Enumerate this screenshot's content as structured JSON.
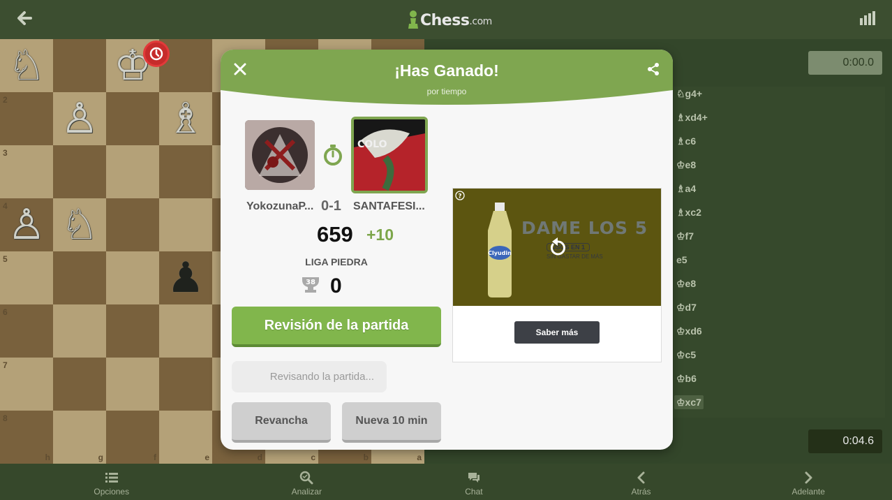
{
  "header": {
    "brand": "Chess",
    "brand_domain": ".com"
  },
  "board": {
    "ranks": [
      "",
      "2",
      "3",
      "4",
      "5",
      "6",
      "7",
      "8"
    ],
    "files": [
      "h",
      "g",
      "f",
      "e",
      "d",
      "c",
      "b",
      "a"
    ],
    "pieces": {
      "0-0": "♘",
      "0-2": "♔",
      "1-1": "♙",
      "1-3": "♗",
      "3-0": "♙",
      "3-1": "♘",
      "4-3": "♟"
    },
    "black_pieces": [
      "4-3"
    ]
  },
  "clocks": {
    "top": "0:00.0",
    "bottom": "0:04.6"
  },
  "moves": [
    "♘g4+",
    "♗xd4+",
    "♗c6",
    "♔e8",
    "♗a4",
    "♗xc2",
    "♔f7",
    "e5",
    "♔e8",
    "♔d7",
    "♔xd6",
    "♔c5",
    "♔b6",
    "♔xc7"
  ],
  "current_move_index": 13,
  "modal": {
    "title": "¡Has Ganado!",
    "subtitle": "por tiempo",
    "player_left": "YokozunaP...",
    "player_right": "SANTAFESI...",
    "score": "0-1",
    "rating": "659",
    "rating_change": "+10",
    "league": "LIGA PIEDRA",
    "trophy_level": "38",
    "trophies": "0",
    "review_button": "Revisión de la partida",
    "reviewing_text": "Revisando la partida...",
    "rematch_button": "Revancha",
    "new_game_button": "Nueva 10 min"
  },
  "ad": {
    "headline": "DAME LOS 5",
    "badge": "USOS EN 1",
    "tagline": "SIN GASTAR DE MÁS",
    "bottle_brand": "Clyudin",
    "cta": "Saber más"
  },
  "bottom_nav": {
    "options": "Opciones",
    "analyze": "Analizar",
    "chat": "Chat",
    "back": "Atrás",
    "forward": "Adelante"
  },
  "colors": {
    "accent_green": "#81b64c",
    "header_bg": "#3c4e30",
    "badge_red": "#c62b2b"
  }
}
